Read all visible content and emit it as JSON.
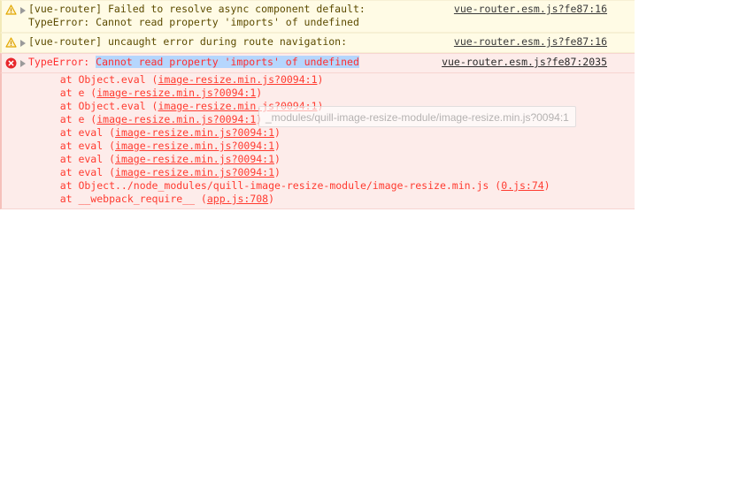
{
  "console": {
    "messages": [
      {
        "level": "warning",
        "level_icon": "warning-triangle-icon",
        "expandable": true,
        "text_line1": "[vue-router] Failed to resolve async component default:",
        "text_line2": "TypeError: Cannot read property 'imports' of undefined",
        "anchor": "vue-router.esm.js?fe87:16"
      },
      {
        "level": "warning",
        "level_icon": "warning-triangle-icon",
        "expandable": true,
        "text_line1": "[vue-router] uncaught error during route navigation:",
        "text_line2": "",
        "anchor": "vue-router.esm.js?fe87:16"
      },
      {
        "level": "error",
        "level_icon": "error-circle-icon",
        "expandable": true,
        "prefix": "TypeError: ",
        "selected_text": "Cannot read property 'imports' of undefined",
        "anchor": "vue-router.esm.js?fe87:2035",
        "stack": [
          {
            "fn": "    at Object.eval (",
            "link": "image-resize.min.js?0094:1",
            "tail": ")"
          },
          {
            "fn": "    at e (",
            "link": "image-resize.min.js?0094:1",
            "tail": ")"
          },
          {
            "fn": "    at Object.eval (",
            "link": "image-resize.min.js?0094:1",
            "tail": ")"
          },
          {
            "fn": "    at e (",
            "link": "image-resize.min.js?0094:1",
            "tail": ")"
          },
          {
            "fn": "    at eval (",
            "link": "image-resize.min.js?0094:1",
            "tail": ")"
          },
          {
            "fn": "    at eval (",
            "link": "image-resize.min.js?0094:1",
            "tail": ")"
          },
          {
            "fn": "    at eval (",
            "link": "image-resize.min.js?0094:1",
            "tail": ")"
          },
          {
            "fn": "    at eval (",
            "link": "image-resize.min.js?0094:1",
            "tail": ")"
          },
          {
            "fn": "    at Object../node_modules/quill-image-resize-module/image-resize.min.js (",
            "link": "0.js:74",
            "tail": ")"
          },
          {
            "fn": "    at __webpack_require__ (",
            "link": "app.js:708",
            "tail": ")"
          }
        ]
      }
    ]
  },
  "tooltip": {
    "text": "_modules/quill-image-resize-module/image-resize.min.js?0094:1"
  },
  "colors": {
    "warning_bg": "#fffbe5",
    "warning_text": "#5c4b00",
    "error_bg": "#fdecea",
    "error_text": "#ff2f2f",
    "selection_bg": "#b5d6fd",
    "link": "#3a3a3a"
  }
}
